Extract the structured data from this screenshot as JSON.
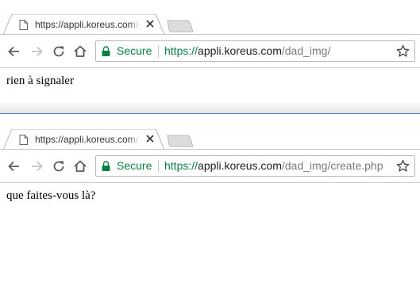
{
  "windows": [
    {
      "tab": {
        "title": "https://appli.koreus.com/dad_img/"
      },
      "omnibox": {
        "secure_label": "Secure",
        "url_scheme": "https://",
        "url_host": "appli.koreus.com",
        "url_path": "/dad_img/"
      },
      "content": {
        "text": "rien à signaler"
      }
    },
    {
      "tab": {
        "title": "https://appli.koreus.com/dad_img/create.php"
      },
      "omnibox": {
        "secure_label": "Secure",
        "url_scheme": "https://",
        "url_host": "appli.koreus.com",
        "url_path": "/dad_img/create.php"
      },
      "content": {
        "text": "que faites-vous là?"
      }
    }
  ],
  "icons": {
    "back": "back-arrow-icon",
    "forward": "forward-arrow-icon",
    "reload": "reload-icon",
    "home": "home-icon",
    "lock": "lock-icon",
    "star": "star-icon",
    "page": "page-icon",
    "close": "close-icon"
  },
  "colors": {
    "secure_green": "#0b8043",
    "url_path_gray": "#7a7a7a",
    "divider_blue": "#3b7fd6"
  }
}
